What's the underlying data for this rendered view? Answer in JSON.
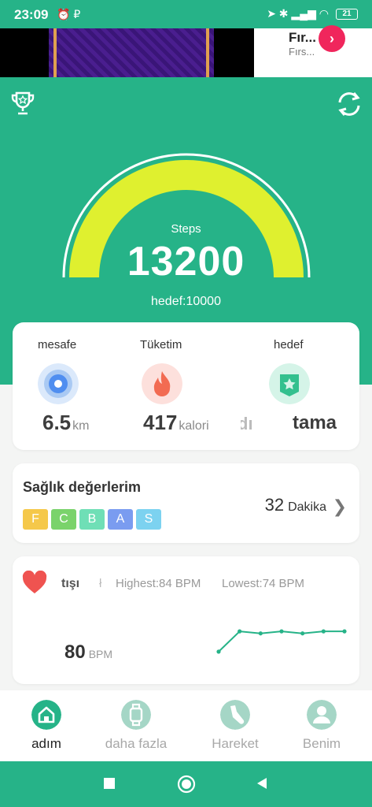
{
  "status_bar": {
    "time": "23:09",
    "left_icons": "⏰ ₽",
    "right_icons": "➤ ✱ ▂▄▆ ◠",
    "battery": "21"
  },
  "ad": {
    "title": "Fır...",
    "subtitle": "Fırs...",
    "arrow": "›"
  },
  "header": {
    "trophy_icon": "trophy-icon",
    "sync_icon": "sync-icon"
  },
  "steps": {
    "label": "Steps",
    "value": "13200",
    "goal_text": "hedef:10000",
    "progress_fraction": 0.75
  },
  "stats": [
    {
      "label": "mesafe",
      "value": "6.5",
      "unit": "km",
      "icon": "location-pin-icon"
    },
    {
      "label": "Tüketim",
      "value": "417",
      "unit": "kalori",
      "icon": "flame-icon"
    },
    {
      "label": "hedef",
      "value_partial": "dı",
      "value": "tama",
      "icon": "star-badge-icon"
    }
  ],
  "health": {
    "title": "Sağlık değerlerim",
    "grades": [
      "F",
      "C",
      "B",
      "A",
      "S"
    ],
    "grade_colors": [
      "#f5c84a",
      "#7ad36b",
      "#6fdfb6",
      "#7a9cf0",
      "#7cd2f0"
    ],
    "duration_value": "32",
    "duration_unit": "Dakika"
  },
  "heart_rate": {
    "title": "tışı",
    "divider": "ł",
    "highest": "Highest:84  BPM",
    "lowest": "Lowest:74  BPM",
    "value": "80",
    "unit": "BPM",
    "series": [
      74,
      84,
      83,
      84,
      83,
      84,
      84
    ]
  },
  "bottom_nav": [
    {
      "label": "adım",
      "active": true,
      "icon": "home-icon"
    },
    {
      "label": "daha fazla",
      "active": false,
      "icon": "watch-icon"
    },
    {
      "label": "Hareket",
      "active": false,
      "icon": "shoe-icon"
    },
    {
      "label": "Benim",
      "active": false,
      "icon": "person-icon"
    }
  ],
  "colors": {
    "brand": "#26b388",
    "gauge": "#dff02f",
    "inactive": "#a5d6c6",
    "heart": "#ef5350"
  }
}
